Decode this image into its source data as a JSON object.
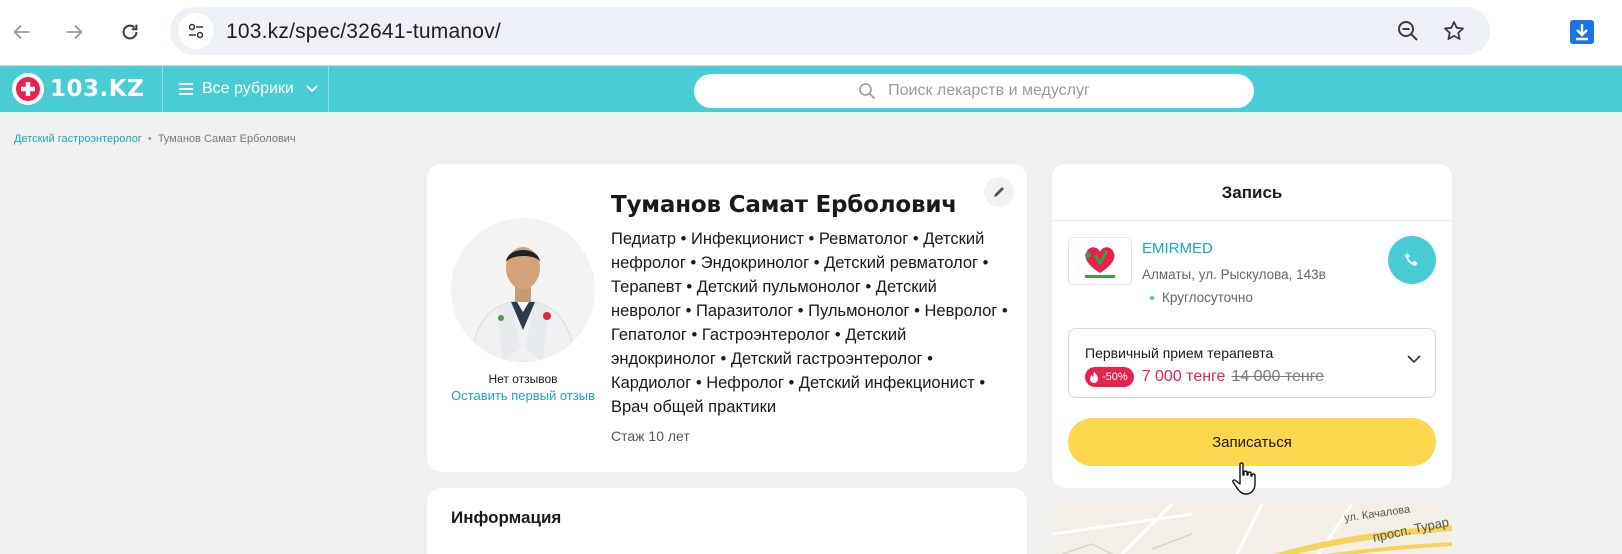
{
  "browser": {
    "url": "103.kz/spec/32641-tumanov/",
    "icons": {
      "back": "arrow-left-icon",
      "forward": "arrow-right-icon",
      "reload": "reload-icon",
      "site_info": "tune-icon",
      "zoom": "zoom-out-icon",
      "bookmark": "star-icon",
      "download": "download-icon"
    }
  },
  "header": {
    "logo_text": "103.KZ",
    "rubrics_label": "Все рубрики",
    "search_placeholder": "Поиск лекарств и медуслуг",
    "accent_color": "#4accd4"
  },
  "breadcrumb": {
    "parent": "Детский гастроэнтеролог",
    "separator": "•",
    "current": "Туманов Самат Ерболович"
  },
  "doctor": {
    "name": "Туманов Самат Ерболович",
    "specialties": "Педиатр • Инфекционист • Ревматолог • Детский нефролог • Эндокринолог • Детский ревматолог • Терапевт • Детский пульмонолог • Детский невролог • Паразитолог • Пульмонолог • Невролог • Гепатолог • Гастроэнтеролог • Детский эндокринолог • Детский гастроэнтеролог • Кардиолог • Нефролог • Детский инфекционист • Врач общей практики",
    "experience": "Стаж 10 лет",
    "no_reviews": "Нет отзывов",
    "leave_review": "Оставить первый отзыв"
  },
  "info": {
    "title": "Информация"
  },
  "booking": {
    "title": "Запись",
    "clinic": {
      "name": "EMIRMED",
      "address": "Алматы, ул. Рыскулова, 143в",
      "hours": "Круглосуточно"
    },
    "service": {
      "name": "Первичный прием терапевта",
      "discount": "-50%",
      "price_new": "7 000 тенге",
      "price_old": "14 000 тенге"
    },
    "book_label": "Записаться",
    "button_color": "#fdd84f",
    "sale_color": "#e8224b"
  },
  "map": {
    "street_1": "ул. Качалова",
    "street_2": "просп. Турар"
  }
}
